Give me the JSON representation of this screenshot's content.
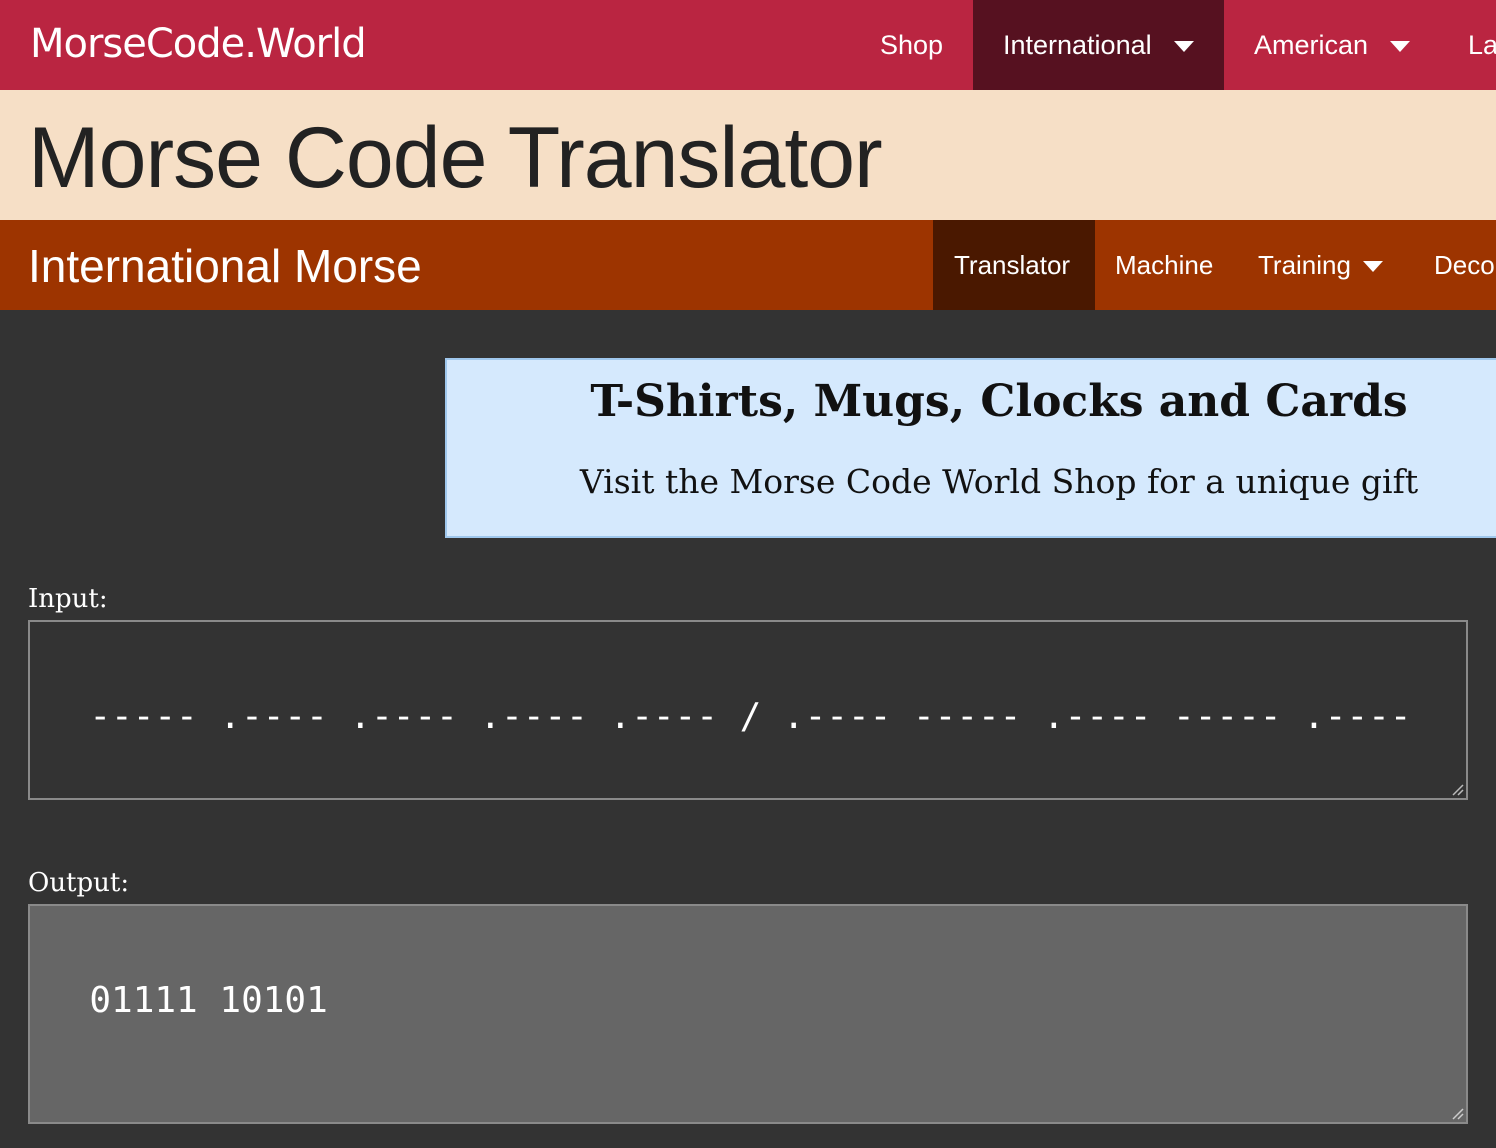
{
  "topbar": {
    "brand": "MorseCode.World",
    "nav": [
      {
        "label": "Shop",
        "dropdown": false,
        "active": false
      },
      {
        "label": "International",
        "dropdown": true,
        "active": true
      },
      {
        "label": "American",
        "dropdown": true,
        "active": false
      },
      {
        "label": "La",
        "dropdown": false,
        "active": false
      }
    ]
  },
  "page": {
    "title": "Morse Code Translator"
  },
  "section": {
    "title": "International Morse",
    "nav": [
      {
        "label": "Translator",
        "dropdown": false,
        "active": true
      },
      {
        "label": "Machine",
        "dropdown": false,
        "active": false
      },
      {
        "label": "Training",
        "dropdown": true,
        "active": false
      },
      {
        "label": "Deco",
        "dropdown": false,
        "active": false
      }
    ]
  },
  "promo": {
    "title": "T-Shirts, Mugs, Clocks and Cards",
    "text": "Visit the Morse Code World Shop for a unique gift"
  },
  "translator": {
    "input_label": "Input:",
    "input_value": "----- .---- .---- .---- .---- / .---- ----- .---- ----- .----",
    "output_label": "Output:",
    "output_value": "01111 10101"
  },
  "colors": {
    "topbar": "#ba2541",
    "topbar_active": "#561120",
    "title_bg": "#f6dfc6",
    "subbar": "#9d3400",
    "subbar_active": "#4a1800",
    "page_bg": "#333333",
    "promo_bg": "#d5e9fd",
    "output_bg": "#666666"
  }
}
